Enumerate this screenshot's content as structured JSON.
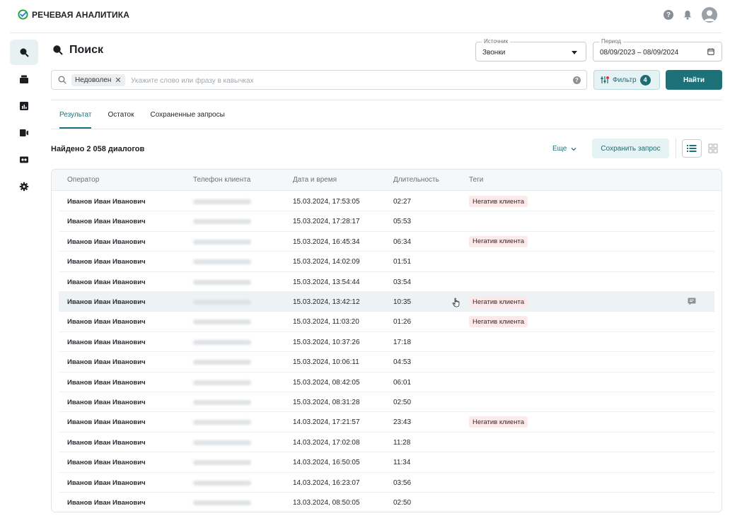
{
  "app": {
    "title": "РЕЧЕВАЯ АНАЛИТИКА"
  },
  "colors": {
    "accent": "#1d7279",
    "tag_bg": "#fde9e9",
    "logo_green": "#21a038",
    "logo_blue": "#1e88e5"
  },
  "top_icons": [
    "help-icon",
    "bell-icon",
    "avatar"
  ],
  "sidebar": {
    "items": [
      {
        "name": "search",
        "icon": "search-icon",
        "active": true
      },
      {
        "name": "folders",
        "icon": "folder-icon",
        "active": false
      },
      {
        "name": "reports",
        "icon": "chart-icon",
        "active": false
      },
      {
        "name": "video",
        "icon": "camera-icon",
        "active": false
      },
      {
        "name": "audio",
        "icon": "tape-icon",
        "active": false
      },
      {
        "name": "settings",
        "icon": "gear-icon",
        "active": false
      }
    ]
  },
  "page": {
    "title": "Поиск"
  },
  "source": {
    "label": "Источник",
    "value": "Звонки"
  },
  "period": {
    "label": "Период",
    "value": "08/09/2023 – 08/09/2024"
  },
  "search": {
    "chip": "Недоволен",
    "placeholder": "Укажите слово или фразу в кавычках"
  },
  "filter": {
    "label": "Фильтр",
    "count": "4"
  },
  "find_button": "Найти",
  "tabs": [
    {
      "label": "Результат",
      "active": true
    },
    {
      "label": "Остаток",
      "active": false
    },
    {
      "label": "Сохраненные запросы",
      "active": false
    }
  ],
  "results": {
    "found": "Найдено 2 058 диалогов",
    "more": "Еще",
    "save_query": "Сохранить запрос"
  },
  "table": {
    "headers": [
      "Оператор",
      "Телефон клиента",
      "Дата и время",
      "Длительность",
      "Теги"
    ],
    "rows": [
      {
        "operator": "Иванов Иван Иванович",
        "datetime": "15.03.2024, 17:53:05",
        "duration": "02:27",
        "tag": "Негатив клиента"
      },
      {
        "operator": "Иванов Иван Иванович",
        "datetime": "15.03.2024, 17:28:17",
        "duration": "05:53",
        "tag": ""
      },
      {
        "operator": "Иванов Иван Иванович",
        "datetime": "15.03.2024, 16:45:34",
        "duration": "06:34",
        "tag": "Негатив клиента"
      },
      {
        "operator": "Иванов Иван Иванович",
        "datetime": "15.03.2024, 14:02:09",
        "duration": "01:51",
        "tag": ""
      },
      {
        "operator": "Иванов Иван Иванович",
        "datetime": "15.03.2024, 13:54:44",
        "duration": "03:54",
        "tag": ""
      },
      {
        "operator": "Иванов Иван Иванович",
        "datetime": "15.03.2024, 13:42:12",
        "duration": "10:35",
        "tag": "Негатив клиента",
        "hover": true
      },
      {
        "operator": "Иванов Иван Иванович",
        "datetime": "15.03.2024, 11:03:20",
        "duration": "01:26",
        "tag": "Негатив клиента"
      },
      {
        "operator": "Иванов Иван Иванович",
        "datetime": "15.03.2024, 10:37:26",
        "duration": "17:18",
        "tag": ""
      },
      {
        "operator": "Иванов Иван Иванович",
        "datetime": "15.03.2024, 10:06:11",
        "duration": "04:53",
        "tag": ""
      },
      {
        "operator": "Иванов Иван Иванович",
        "datetime": "15.03.2024, 08:42:05",
        "duration": "06:01",
        "tag": ""
      },
      {
        "operator": "Иванов Иван Иванович",
        "datetime": "15.03.2024, 08:31:28",
        "duration": "02:50",
        "tag": ""
      },
      {
        "operator": "Иванов Иван Иванович",
        "datetime": "14.03.2024, 17:21:57",
        "duration": "23:43",
        "tag": "Негатив клиента"
      },
      {
        "operator": "Иванов Иван Иванович",
        "datetime": "14.03.2024, 17:02:08",
        "duration": "11:28",
        "tag": ""
      },
      {
        "operator": "Иванов Иван Иванович",
        "datetime": "14.03.2024, 16:50:05",
        "duration": "11:34",
        "tag": ""
      },
      {
        "operator": "Иванов Иван Иванович",
        "datetime": "14.03.2024, 16:23:07",
        "duration": "03:56",
        "tag": ""
      },
      {
        "operator": "Иванов Иван Иванович",
        "datetime": "13.03.2024, 08:50:05",
        "duration": "02:50",
        "tag": ""
      }
    ]
  }
}
